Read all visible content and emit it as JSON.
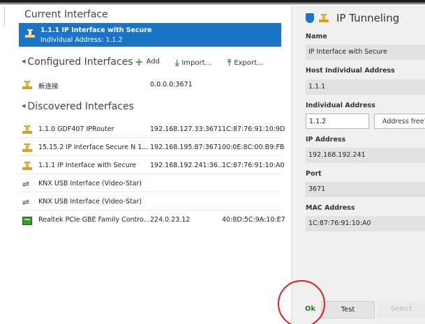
{
  "current": {
    "title": "Current Interface",
    "name": "1.1.1 IP Interface with Secure",
    "address": "Individual Address: 1.1.2"
  },
  "configured": {
    "title": "Configured Interfaces",
    "toolbar": {
      "add_label": "Add",
      "import_label": "Import...",
      "export_label": "Export..."
    },
    "rows": [
      {
        "name": "新连接",
        "ip": "0.0.0.0:3671",
        "mac": "",
        "icon": "knx-icon"
      }
    ]
  },
  "discovered": {
    "title": "Discovered Interfaces",
    "rows": [
      {
        "name": "1.1.0 GDF407 IPRouter",
        "ip": "192.168.127.33:3671",
        "mac": "1C:87:76:91:10:9D",
        "icon": "knx-icon"
      },
      {
        "name": "15.15.2 IP Interface Secure N 1...",
        "ip": "192.168.195.87:3671",
        "mac": "00:0E:8C:00:B9:FB",
        "icon": "knx-icon"
      },
      {
        "name": "1.1.1 IP Interface with Secure",
        "ip": "192.168.192.241:36...",
        "mac": "1C:87:76:91:10:A0",
        "icon": "knx-icon"
      },
      {
        "name": "KNX USB Interface (Video-Star)",
        "ip": "",
        "mac": "",
        "icon": "usb-icon"
      },
      {
        "name": "KNX USB Interface (Video-Star)",
        "ip": "",
        "mac": "",
        "icon": "usb-icon"
      },
      {
        "name": "Realtek PCIe GBE Family Contro...",
        "ip": "224.0.23.12",
        "mac": "40:8D:5C:9A:10:E7",
        "icon": "network-card-icon"
      }
    ]
  },
  "details": {
    "title": "IP Tunneling",
    "name_label": "Name",
    "name_value": "IP Interface with Secure",
    "host_label": "Host Individual Address",
    "host_value": "1.1.1",
    "individual_label": "Individual Address",
    "individual_value": "1.1.2",
    "address_free_label": "Address free?",
    "ip_label": "IP Address",
    "ip_value": "192.168.192.241",
    "port_label": "Port",
    "port_value": "3671",
    "mac_label": "MAC Address",
    "mac_value": "1C:87:76:91:10:A0"
  },
  "buttons": {
    "ok": "Ok",
    "test": "Test",
    "select": "Select"
  },
  "colors": {
    "accent": "#1a74c8",
    "ok_green": "#2f7a1f",
    "highlight_circle": "#e01b1b"
  }
}
